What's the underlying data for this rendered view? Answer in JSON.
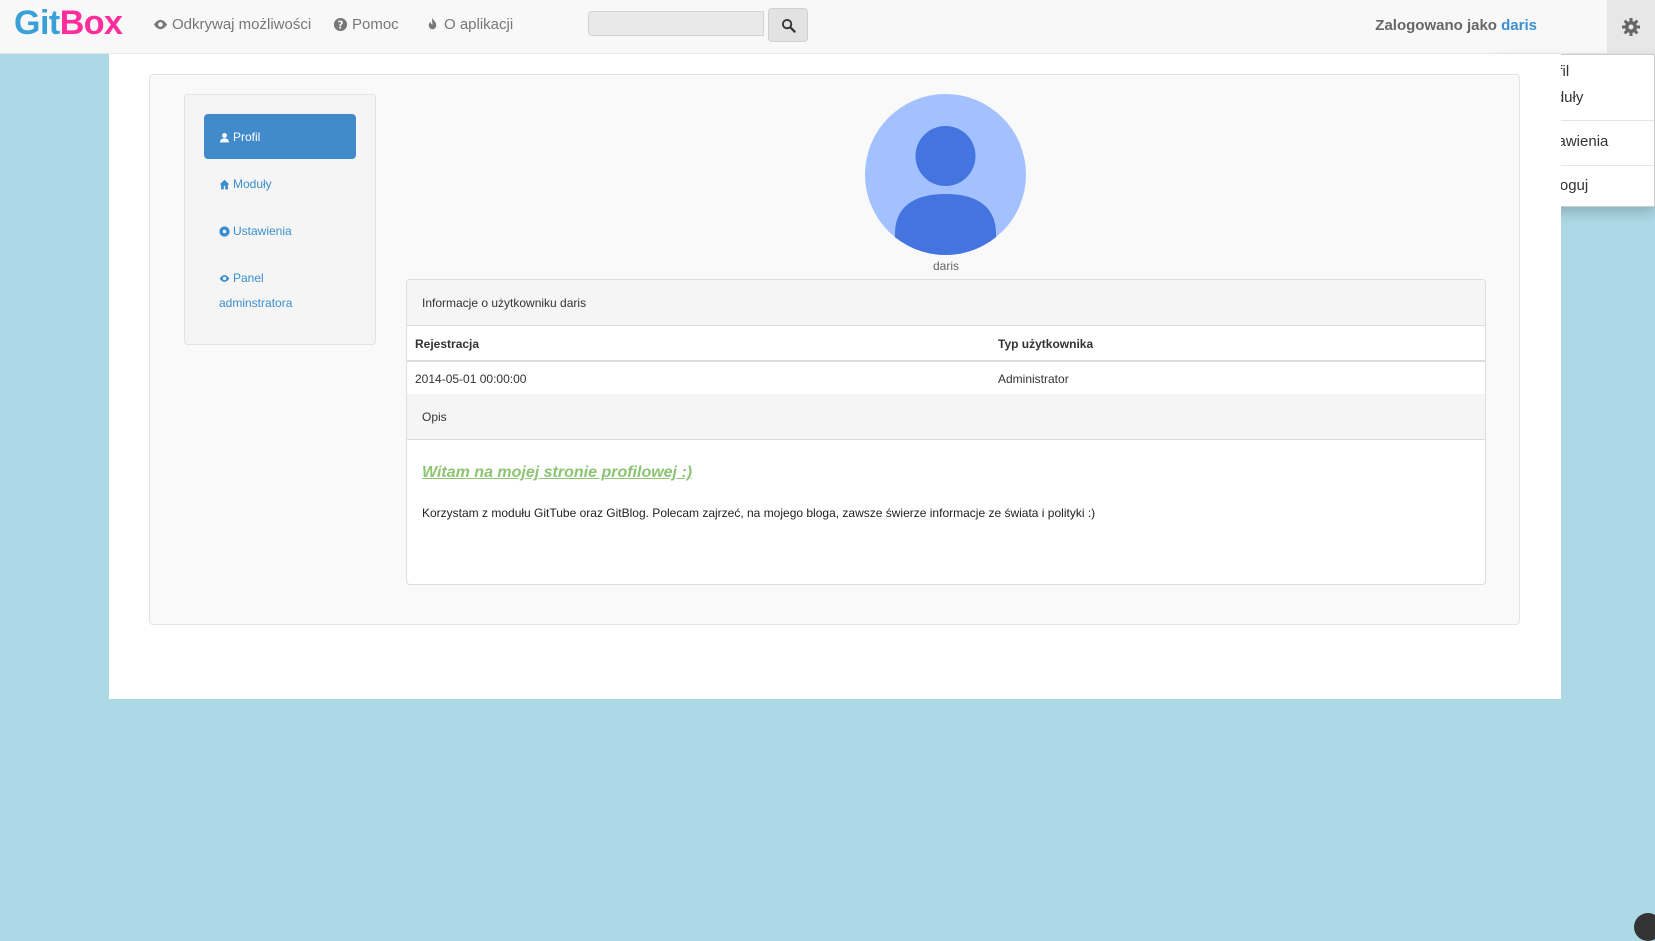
{
  "brand": {
    "part1": "Git",
    "part2": "Box"
  },
  "nav": {
    "discover": "Odkrywaj możliwości",
    "help": "Pomoc",
    "about": "O aplikacji"
  },
  "search": {
    "placeholder": ""
  },
  "header": {
    "logged_prefix": "Zalogowano jako",
    "username": "daris"
  },
  "dropdown": {
    "profile": "Profil",
    "modules": "Moduły",
    "settings": "Ustawienia",
    "logout": "Wyloguj"
  },
  "sidebar": {
    "profile": "Profil",
    "modules": "Moduły",
    "settings": "Ustawienia",
    "admin_line1": "Panel",
    "admin_line2": "adminstratora"
  },
  "profile": {
    "username": "daris",
    "info_heading": "Informacje o użytkowniku daris",
    "col_registration": "Rejestracja",
    "col_user_type": "Typ użytkownika",
    "registration_value": "2014-05-01 00:00:00",
    "user_type_value": "Administrator",
    "desc_heading": "Opis",
    "greeting": "Witam  na mojej stronie profilowej :)",
    "description": "Korzystam z modułu GitTube oraz GitBlog. Polecam zajrzeć, na mojego bloga, zawsze świerze informacje ze świata i polityki :)"
  },
  "colors": {
    "brand_git": "#3aa0d8",
    "brand_box": "#ff2d9b",
    "primary": "#428bca",
    "link": "#3a8fd0",
    "greeting": "#8cc473",
    "background": "#add8e6"
  }
}
